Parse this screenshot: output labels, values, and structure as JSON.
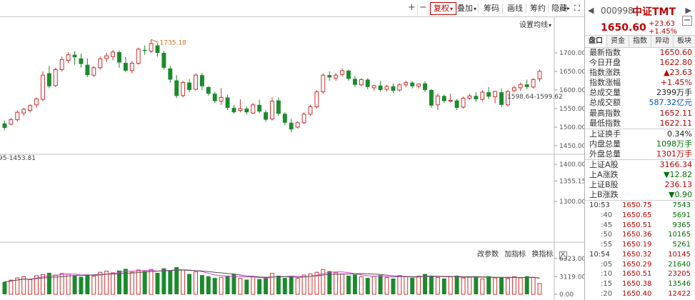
{
  "toolbar": {
    "plus": "+",
    "minus": "−",
    "buttons": [
      {
        "label": "复权",
        "active": true,
        "dropdown": true
      },
      {
        "label": "叠加",
        "active": false,
        "dropdown": true
      },
      {
        "label": "筹码",
        "active": false,
        "dropdown": false
      },
      {
        "label": "画线",
        "active": false,
        "dropdown": false
      },
      {
        "label": "筹约",
        "active": false,
        "dropdown": false
      },
      {
        "label": "隐藏",
        "active": false,
        "dropdown": false
      }
    ],
    "more_icon": "▸▸",
    "fullscreen_icon": "⛶"
  },
  "chart": {
    "ma_settings": "设置均线",
    "max_annotation": "1735.18",
    "range_left": "95-1453.81",
    "range_right": "1598.64-1599.62",
    "price_ticks": [
      "1700.00",
      "1650.00",
      "1600.00",
      "1550.00",
      "1500.00",
      "1450.00",
      "1400.00",
      "1355.15",
      "1300.00"
    ],
    "volume_ticks": [
      "6323.00",
      "3119.00",
      "0.00"
    ],
    "volume_controls": {
      "change_params": "改参数",
      "add_indicator": "加指标",
      "switch_indicator": "换指标",
      "close": "✕"
    }
  },
  "chart_data": {
    "type": "candlestick",
    "price_ylim": [
      1300,
      1760
    ],
    "volume_ylim": [
      0,
      6323
    ],
    "candles": [
      {
        "o": 1510,
        "h": 1518,
        "c": 1498,
        "l": 1492
      },
      {
        "o": 1508,
        "h": 1525,
        "c": 1520,
        "l": 1505
      },
      {
        "o": 1520,
        "h": 1545,
        "c": 1540,
        "l": 1515
      },
      {
        "o": 1538,
        "h": 1552,
        "c": 1548,
        "l": 1530
      },
      {
        "o": 1545,
        "h": 1562,
        "c": 1558,
        "l": 1540
      },
      {
        "o": 1560,
        "h": 1580,
        "c": 1576,
        "l": 1552
      },
      {
        "o": 1575,
        "h": 1650,
        "c": 1640,
        "l": 1570
      },
      {
        "o": 1645,
        "h": 1665,
        "c": 1610,
        "l": 1605
      },
      {
        "o": 1612,
        "h": 1660,
        "c": 1655,
        "l": 1608
      },
      {
        "o": 1655,
        "h": 1690,
        "c": 1682,
        "l": 1650
      },
      {
        "o": 1680,
        "h": 1702,
        "c": 1695,
        "l": 1672
      },
      {
        "o": 1695,
        "h": 1705,
        "c": 1688,
        "l": 1668
      },
      {
        "o": 1685,
        "h": 1698,
        "c": 1670,
        "l": 1660
      },
      {
        "o": 1668,
        "h": 1685,
        "c": 1640,
        "l": 1635
      },
      {
        "o": 1640,
        "h": 1665,
        "c": 1660,
        "l": 1635
      },
      {
        "o": 1660,
        "h": 1690,
        "c": 1684,
        "l": 1655
      },
      {
        "o": 1685,
        "h": 1700,
        "c": 1692,
        "l": 1675
      },
      {
        "o": 1690,
        "h": 1708,
        "c": 1702,
        "l": 1680
      },
      {
        "o": 1702,
        "h": 1706,
        "c": 1674,
        "l": 1660
      },
      {
        "o": 1673,
        "h": 1690,
        "c": 1652,
        "l": 1648
      },
      {
        "o": 1652,
        "h": 1678,
        "c": 1672,
        "l": 1645
      },
      {
        "o": 1672,
        "h": 1714,
        "c": 1710,
        "l": 1668
      },
      {
        "o": 1708,
        "h": 1720,
        "c": 1705,
        "l": 1695
      },
      {
        "o": 1705,
        "h": 1736,
        "c": 1725,
        "l": 1700
      },
      {
        "o": 1720,
        "h": 1726,
        "c": 1700,
        "l": 1690
      },
      {
        "o": 1700,
        "h": 1705,
        "c": 1660,
        "l": 1655
      },
      {
        "o": 1658,
        "h": 1665,
        "c": 1628,
        "l": 1620
      },
      {
        "o": 1626,
        "h": 1640,
        "c": 1584,
        "l": 1578
      },
      {
        "o": 1585,
        "h": 1625,
        "c": 1620,
        "l": 1580
      },
      {
        "o": 1620,
        "h": 1630,
        "c": 1600,
        "l": 1594
      },
      {
        "o": 1602,
        "h": 1645,
        "c": 1640,
        "l": 1598
      },
      {
        "o": 1640,
        "h": 1646,
        "c": 1610,
        "l": 1600
      },
      {
        "o": 1608,
        "h": 1610,
        "c": 1590,
        "l": 1585
      },
      {
        "o": 1590,
        "h": 1595,
        "c": 1570,
        "l": 1565
      },
      {
        "o": 1570,
        "h": 1605,
        "c": 1580,
        "l": 1560
      },
      {
        "o": 1580,
        "h": 1588,
        "c": 1552,
        "l": 1546
      },
      {
        "o": 1552,
        "h": 1560,
        "c": 1540,
        "l": 1536
      },
      {
        "o": 1545,
        "h": 1575,
        "c": 1550,
        "l": 1540
      },
      {
        "o": 1550,
        "h": 1556,
        "c": 1540,
        "l": 1534
      },
      {
        "o": 1538,
        "h": 1565,
        "c": 1560,
        "l": 1535
      },
      {
        "o": 1560,
        "h": 1574,
        "c": 1542,
        "l": 1538
      },
      {
        "o": 1540,
        "h": 1546,
        "c": 1520,
        "l": 1514
      },
      {
        "o": 1522,
        "h": 1580,
        "c": 1570,
        "l": 1518
      },
      {
        "o": 1572,
        "h": 1580,
        "c": 1536,
        "l": 1530
      },
      {
        "o": 1536,
        "h": 1540,
        "c": 1512,
        "l": 1505
      },
      {
        "o": 1512,
        "h": 1522,
        "c": 1494,
        "l": 1486
      },
      {
        "o": 1500,
        "h": 1515,
        "c": 1512,
        "l": 1496
      },
      {
        "o": 1512,
        "h": 1540,
        "c": 1535,
        "l": 1508
      },
      {
        "o": 1535,
        "h": 1560,
        "c": 1555,
        "l": 1530
      },
      {
        "o": 1555,
        "h": 1600,
        "c": 1595,
        "l": 1550
      },
      {
        "o": 1595,
        "h": 1645,
        "c": 1640,
        "l": 1590
      },
      {
        "o": 1640,
        "h": 1650,
        "c": 1634,
        "l": 1625
      },
      {
        "o": 1632,
        "h": 1646,
        "c": 1640,
        "l": 1625
      },
      {
        "o": 1642,
        "h": 1658,
        "c": 1652,
        "l": 1636
      },
      {
        "o": 1652,
        "h": 1655,
        "c": 1630,
        "l": 1625
      },
      {
        "o": 1630,
        "h": 1638,
        "c": 1614,
        "l": 1608
      },
      {
        "o": 1614,
        "h": 1632,
        "c": 1628,
        "l": 1610
      },
      {
        "o": 1628,
        "h": 1632,
        "c": 1608,
        "l": 1602
      },
      {
        "o": 1606,
        "h": 1614,
        "c": 1612,
        "l": 1598
      },
      {
        "o": 1612,
        "h": 1624,
        "c": 1600,
        "l": 1596
      },
      {
        "o": 1602,
        "h": 1614,
        "c": 1610,
        "l": 1596
      },
      {
        "o": 1610,
        "h": 1618,
        "c": 1598,
        "l": 1592
      },
      {
        "o": 1600,
        "h": 1618,
        "c": 1614,
        "l": 1596
      },
      {
        "o": 1614,
        "h": 1625,
        "c": 1620,
        "l": 1608
      },
      {
        "o": 1620,
        "h": 1624,
        "c": 1610,
        "l": 1604
      },
      {
        "o": 1610,
        "h": 1618,
        "c": 1616,
        "l": 1604
      },
      {
        "o": 1618,
        "h": 1624,
        "c": 1600,
        "l": 1594
      },
      {
        "o": 1600,
        "h": 1602,
        "c": 1558,
        "l": 1552
      },
      {
        "o": 1560,
        "h": 1590,
        "c": 1584,
        "l": 1546
      },
      {
        "o": 1584,
        "h": 1588,
        "c": 1570,
        "l": 1565
      },
      {
        "o": 1570,
        "h": 1590,
        "c": 1572,
        "l": 1566
      },
      {
        "o": 1572,
        "h": 1576,
        "c": 1552,
        "l": 1546
      },
      {
        "o": 1554,
        "h": 1582,
        "c": 1578,
        "l": 1550
      },
      {
        "o": 1578,
        "h": 1590,
        "c": 1584,
        "l": 1574
      },
      {
        "o": 1584,
        "h": 1594,
        "c": 1575,
        "l": 1568
      },
      {
        "o": 1575,
        "h": 1600,
        "c": 1594,
        "l": 1570
      },
      {
        "o": 1594,
        "h": 1608,
        "c": 1582,
        "l": 1576
      },
      {
        "o": 1582,
        "h": 1598,
        "c": 1596,
        "l": 1564
      },
      {
        "o": 1594,
        "h": 1604,
        "c": 1560,
        "l": 1554
      },
      {
        "o": 1560,
        "h": 1600,
        "c": 1596,
        "l": 1556
      },
      {
        "o": 1598,
        "h": 1612,
        "c": 1606,
        "l": 1594
      },
      {
        "o": 1606,
        "h": 1620,
        "c": 1615,
        "l": 1598
      },
      {
        "o": 1615,
        "h": 1628,
        "c": 1608,
        "l": 1602
      },
      {
        "o": 1608,
        "h": 1632,
        "c": 1628,
        "l": 1604
      },
      {
        "o": 1630,
        "h": 1655,
        "c": 1650,
        "l": 1622
      }
    ],
    "volumes": [
      2200,
      2500,
      2900,
      3100,
      2600,
      3300,
      3500,
      3800,
      3400,
      3700,
      3600,
      3300,
      3100,
      3500,
      3200,
      3900,
      4100,
      3800,
      4200,
      4500,
      3900,
      4300,
      4100,
      4400,
      3800,
      4600,
      4200,
      4800,
      4300,
      3600,
      4000,
      3400,
      3200,
      2900,
      3000,
      3300,
      3600,
      2800,
      2600,
      3100,
      2700,
      3000,
      3700,
      3300,
      2900,
      3200,
      2800,
      3400,
      3600,
      3900,
      4400,
      4100,
      3800,
      3600,
      3300,
      3500,
      3100,
      2900,
      3200,
      3400,
      3000,
      2800,
      3300,
      3100,
      2900,
      3200,
      3600,
      3300,
      3000,
      2800,
      3100,
      3300,
      2900,
      3000,
      3100,
      2700,
      3200,
      2900,
      3000,
      2800,
      3100,
      2900,
      3200,
      3000,
      1900
    ]
  },
  "panel": {
    "prev": "◀",
    "next": "▶",
    "code": "000998",
    "name": "中证TMT",
    "price": "1650.60",
    "change": "+23.63",
    "change_pct": "+1.45%",
    "collapse": "−",
    "tabs": [
      "盘口",
      "资金",
      "指数",
      "异动",
      "板块"
    ],
    "stats": [
      {
        "label": "最新指数",
        "value": "1650.60",
        "color": "red"
      },
      {
        "label": "今日开盘",
        "value": "1622.80",
        "color": "red"
      },
      {
        "label": "指数涨跌",
        "value": "▲23.63",
        "color": "red"
      },
      {
        "label": "指数涨幅",
        "value": "+1.45%",
        "color": "red"
      },
      {
        "label": "总成交量",
        "value": "2399万手",
        "color": "black"
      },
      {
        "label": "总成交额",
        "value": "587.32亿元",
        "color": "blue"
      },
      {
        "label": "最高指数",
        "value": "1652.11",
        "color": "red"
      },
      {
        "label": "最低指数",
        "value": "1622.11",
        "color": "red"
      }
    ],
    "stats2": [
      {
        "label": "上证换手",
        "value": "0.34%",
        "color": "black"
      },
      {
        "label": "内盘总量",
        "value": "1098万手",
        "color": "green"
      },
      {
        "label": "外盘总量",
        "value": "1301万手",
        "color": "red"
      }
    ],
    "stats3": [
      {
        "label": "上证A股",
        "value": "3166.34",
        "color": "red"
      },
      {
        "label": "上A涨跌",
        "value": "▼12.82",
        "color": "green"
      },
      {
        "label": "上证B股",
        "value": "236.13",
        "color": "red"
      },
      {
        "label": "上B涨跌",
        "value": "▼0.90",
        "color": "green"
      }
    ],
    "ticks": [
      {
        "time": "10:53",
        "sub": false,
        "price": "1650.75",
        "vol": "7543",
        "up": false
      },
      {
        "time": ":40",
        "sub": true,
        "price": "1650.65",
        "vol": "5691",
        "up": false
      },
      {
        "time": ":45",
        "sub": true,
        "price": "1650.51",
        "vol": "9365",
        "up": false
      },
      {
        "time": ":50",
        "sub": true,
        "price": "1650.36",
        "vol": "10165",
        "up": false
      },
      {
        "time": ":55",
        "sub": true,
        "price": "1650.19",
        "vol": "5261",
        "up": false
      },
      {
        "time": "10:54",
        "sub": false,
        "price": "1650.32",
        "vol": "10145",
        "up": true
      },
      {
        "time": ":05",
        "sub": true,
        "price": "1650.29",
        "vol": "21640",
        "up": false
      },
      {
        "time": ":10",
        "sub": true,
        "price": "1650.51",
        "vol": "23205",
        "up": true
      },
      {
        "time": ":15",
        "sub": true,
        "price": "1650.38",
        "vol": "13546",
        "up": false
      },
      {
        "time": ":20",
        "sub": true,
        "price": "1650.40",
        "vol": "12422",
        "up": true
      }
    ]
  }
}
